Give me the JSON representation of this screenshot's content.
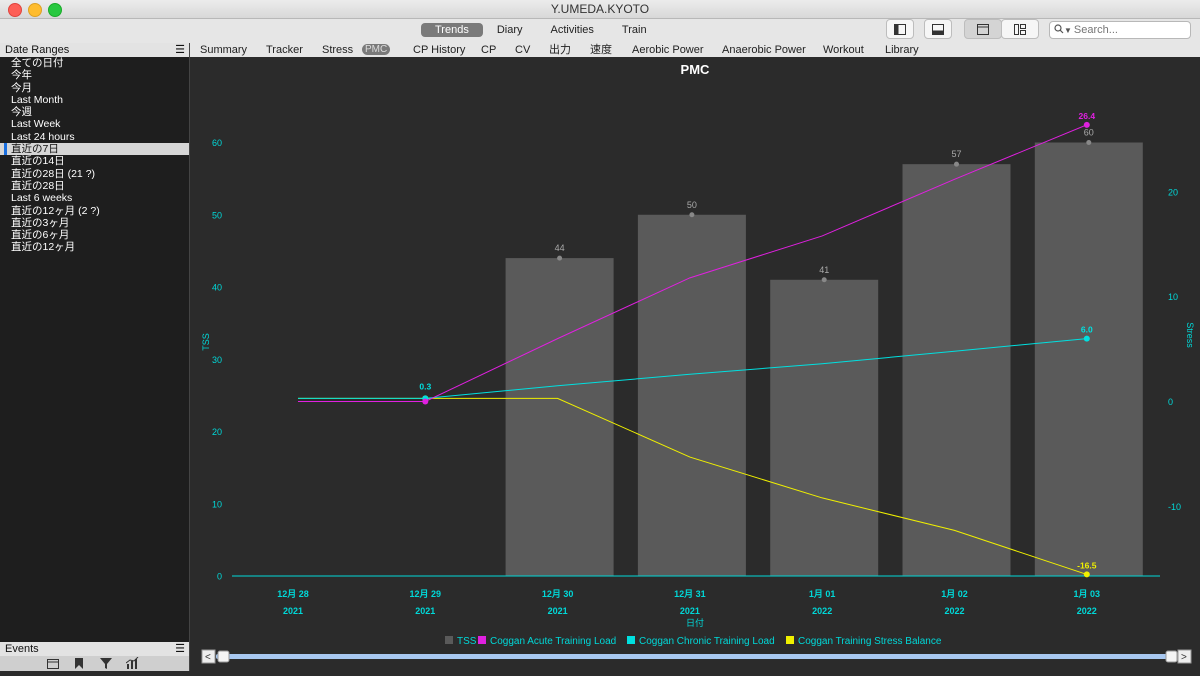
{
  "window": {
    "title": "Y.UMEDA.KYOTO"
  },
  "main_nav": [
    {
      "label": "Trends",
      "active": true
    },
    {
      "label": "Diary",
      "active": false
    },
    {
      "label": "Activities",
      "active": false
    },
    {
      "label": "Train",
      "active": false
    }
  ],
  "search": {
    "placeholder": "Search..."
  },
  "sidebar": {
    "header": "Date Ranges",
    "items": [
      "全ての日付",
      "今年",
      "今月",
      "Last Month",
      "今週",
      "Last Week",
      "Last 24 hours",
      "直近の7日",
      "直近の14日",
      "直近の28日 (21 ?)",
      "直近の28日",
      "Last 6 weeks",
      "直近の12ヶ月 (2 ?)",
      "直近の3ヶ月",
      "直近の6ヶ月",
      "直近の12ヶ月"
    ],
    "selected_index": 7,
    "events_header": "Events"
  },
  "tabs": [
    {
      "label": "Summary",
      "active": false
    },
    {
      "label": "Tracker",
      "active": false
    },
    {
      "label": "Stress",
      "active": false
    },
    {
      "label": "PMC",
      "active": true
    },
    {
      "label": "CP History",
      "active": false
    },
    {
      "label": "CP",
      "active": false
    },
    {
      "label": "CV",
      "active": false
    },
    {
      "label": "出力",
      "active": false
    },
    {
      "label": "速度",
      "active": false
    },
    {
      "label": "Aerobic Power",
      "active": false
    },
    {
      "label": "Anaerobic Power",
      "active": false
    },
    {
      "label": "Workout",
      "active": false
    },
    {
      "label": "Library",
      "active": false
    }
  ],
  "colors": {
    "tss": "#5a5a5a",
    "atl": "#e020e0",
    "ctl": "#00e0e0",
    "tsb": "#f0f000",
    "axis": "#00d8d8",
    "bar_label": "#aaaaaa"
  },
  "chart_data": {
    "type": "bar",
    "title": "PMC",
    "xlabel": "日付",
    "ylabel": "TSS",
    "y2label": "Stress",
    "categories": [
      "12月 28",
      "12月 29",
      "12月 30",
      "12月 31",
      "1月 01",
      "1月 02",
      "1月 03"
    ],
    "category_years": [
      "2021",
      "2021",
      "2021",
      "2021",
      "2022",
      "2022",
      "2022"
    ],
    "ylim": [
      0,
      60
    ],
    "yticks": [
      0,
      10,
      20,
      30,
      40,
      50,
      60
    ],
    "y2lim": [
      -16.5,
      26.4
    ],
    "y2ticks": [
      -10,
      0,
      10,
      20
    ],
    "series": [
      {
        "name": "TSS",
        "axis": "left",
        "kind": "bar",
        "values": [
          null,
          null,
          44,
          50,
          41,
          57,
          60
        ],
        "labels": [
          "",
          "",
          "44",
          "50",
          "41",
          "57",
          "60"
        ]
      },
      {
        "name": "Coggan Acute Training Load",
        "axis": "right",
        "kind": "line",
        "values": [
          0.0,
          0.0,
          6.0,
          11.8,
          15.8,
          21.2,
          26.4
        ],
        "end_label": "26.4"
      },
      {
        "name": "Coggan Chronic Training Load",
        "axis": "right",
        "kind": "line",
        "values": [
          0.3,
          0.3,
          1.5,
          2.6,
          3.6,
          4.8,
          6.0
        ],
        "start_label": "0.3",
        "end_label": "6.0"
      },
      {
        "name": "Coggan Training Stress Balance",
        "axis": "right",
        "kind": "line",
        "values": [
          0.3,
          0.3,
          0.3,
          -5.3,
          -9.2,
          -12.3,
          -16.5
        ],
        "end_label": "-16.5"
      }
    ],
    "legend": "bottom",
    "grid": false
  }
}
